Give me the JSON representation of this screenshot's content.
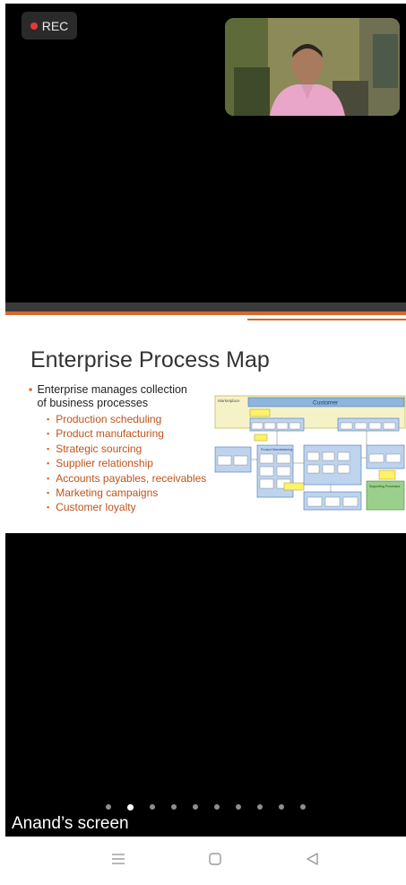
{
  "recording": {
    "label": "REC",
    "dot_color": "#e53935"
  },
  "video": {
    "participant_feed": "participant-camera"
  },
  "slide": {
    "title": "Enterprise Process Map",
    "main_bullet_line1": "Enterprise manages collection",
    "main_bullet_line2": "of business processes",
    "sub_bullets": [
      "Production scheduling",
      "Product manufacturing",
      "Strategic sourcing",
      "Supplier relationship",
      "Accounts payables, receivables",
      "Marketing campaigns",
      "Customer loyalty"
    ],
    "diagram": {
      "customer_label": "Customer",
      "marketplace_label": "Marketplace",
      "manufacturing_label": "Product Manufacturing",
      "supporting_label": "Supporting Processes"
    },
    "accent_color": "#d5682a"
  },
  "pagination": {
    "count": 10,
    "active_index": 1
  },
  "screen_owner": "Anand’s screen",
  "navbar": {
    "icons": [
      "menu-icon",
      "home-icon",
      "back-icon"
    ]
  }
}
